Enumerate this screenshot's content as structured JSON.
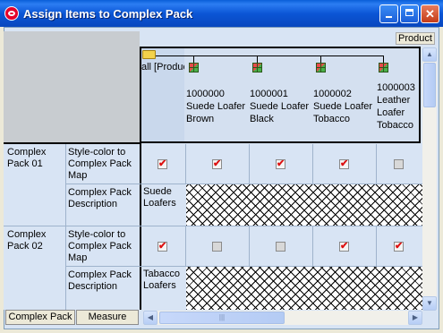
{
  "window": {
    "title": "Assign Items to Complex Pack",
    "minimize_icon": "minimize-icon",
    "maximize_icon": "maximize-icon",
    "close_icon": "close-icon"
  },
  "header": {
    "product_button": "Product",
    "root_label": "all [Product]",
    "columns": [
      {
        "line1": "1000000",
        "line2": "Suede Loafer",
        "line3": "Brown"
      },
      {
        "line1": "1000001",
        "line2": "Suede Loafer",
        "line3": "Black"
      },
      {
        "line1": "1000002",
        "line2": "Suede Loafer",
        "line3": "Tobacco"
      },
      {
        "line1": "1000003",
        "line2": "Leather",
        "line3": "Loafer",
        "line4": "Tobacco"
      }
    ]
  },
  "rows": [
    {
      "pack": "Complex Pack 01",
      "measure_map": "Style-color to Complex Pack Map",
      "measure_desc": "Complex Pack Description",
      "root_check": true,
      "checks": [
        true,
        true,
        true,
        true,
        false
      ],
      "description": "Suede Loafers"
    },
    {
      "pack": "Complex Pack 02",
      "measure_map": "Style-color to Complex Pack Map",
      "measure_desc": "Complex Pack Description",
      "root_check": true,
      "checks": [
        true,
        false,
        false,
        true,
        true
      ],
      "description": "Tabacco Loafers"
    }
  ],
  "tabs": {
    "complex_pack": "Complex Pack",
    "measure": "Measure"
  },
  "scroll": {
    "up": "▲",
    "down": "▼",
    "left": "◀",
    "right": "▶",
    "grip": "|||"
  }
}
